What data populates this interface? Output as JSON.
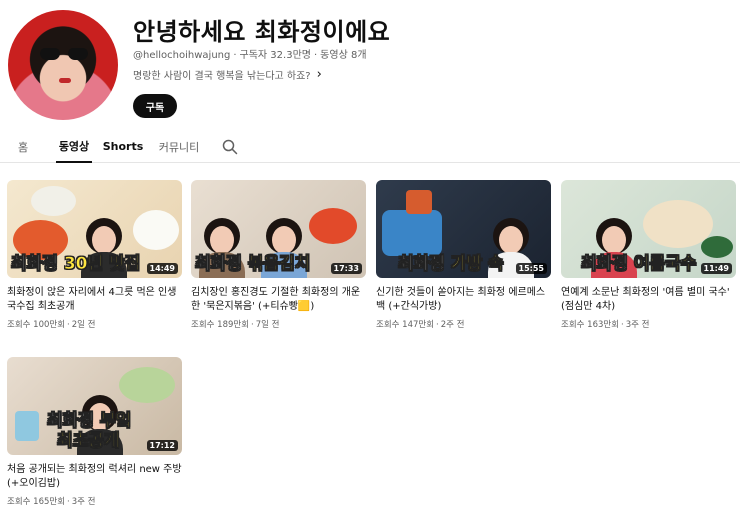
{
  "channel": {
    "name": "안녕하세요 최화정이에요",
    "handle": "@hellochoihwajung",
    "subscribers": "구독자 32.3만명",
    "video_count": "동영상 8개",
    "description": "명랑한 사람이 결국 행복을 낚는다고 하죠?",
    "subscribe_label": "구독"
  },
  "tabs": [
    {
      "label": "홈"
    },
    {
      "label": "동영상"
    },
    {
      "label": "Shorts"
    },
    {
      "label": "커뮤니티"
    }
  ],
  "videos": [
    {
      "overlay_a": "최화정 ",
      "overlay_b": "30년 맛집",
      "duration": "14:49",
      "title": "최화정이 앉은 자리에서 4그릇 먹은 인생 국수집 최초공개",
      "views": "조회수 100만회",
      "age": "2일 전"
    },
    {
      "overlay_a": "최화정 ",
      "overlay_b": "볶음김치",
      "duration": "17:33",
      "title": "김치장인 홍진경도 기절한 최화정의 개운한 '묵은지볶음' (+티슈빵🟨)",
      "views": "조회수 189만회",
      "age": "7일 전"
    },
    {
      "overlay_a": "최화정 ",
      "overlay_b": "가방 속",
      "duration": "15:55",
      "title": "신기한 것들이 쏟아지는 최화정 에르메스백 (+간식가방)",
      "views": "조회수 147만회",
      "age": "2주 전"
    },
    {
      "overlay_a": "최화정 ",
      "overlay_b": "여름국수",
      "duration": "11:49",
      "title": "연예계 소문난 최화정의 '여름 별미 국수' (점심만 4차)",
      "views": "조회수 163만회",
      "age": "3주 전"
    },
    {
      "overlay_a": "최화정 ",
      "overlay_b": "부엌",
      "overlay_c": "최초공개",
      "duration": "17:12",
      "title": "처음 공개되는 최화정의 럭셔리 new 주방 (+오이김밥)",
      "views": "조회수 165만회",
      "age": "3주 전"
    }
  ],
  "icons": {
    "search": "search-icon",
    "chevron": "chevron-right-icon"
  },
  "colors": {
    "accent_text": "#0f0f0f",
    "secondary_text": "#606060",
    "overlay_highlight": "#ffe640",
    "avatar_bg": "#c9201f"
  }
}
